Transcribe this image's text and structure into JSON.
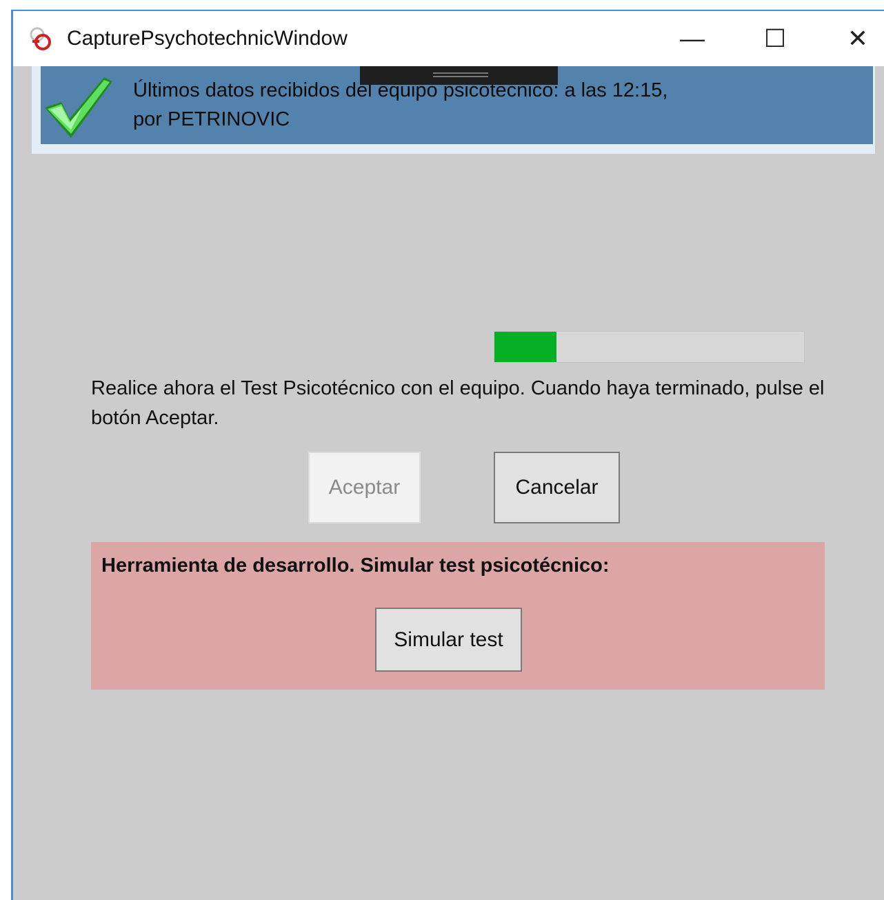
{
  "window": {
    "title": "CapturePsychotechnicWindow",
    "controls": {
      "minimize": "—",
      "maximize": "☐",
      "close": "✕"
    }
  },
  "status": {
    "icon": "check-icon",
    "line1": "Últimos datos recibidos del equipo psicotécnico: a las 12:15,",
    "line2": "por PETRINOVIC"
  },
  "progress": {
    "value_percent": 20,
    "color": "#06b025"
  },
  "instructions": "Realice ahora el Test Psicotécnico con el equipo. Cuando haya terminado, pulse el botón Aceptar.",
  "buttons": {
    "accept": "Aceptar",
    "cancel": "Cancelar"
  },
  "dev_tools": {
    "title": "Herramienta de desarrollo. Simular test psicotécnico:",
    "simulate": "Simular test",
    "background": "#dca6a6"
  },
  "colors": {
    "status_bar": "#5383ad",
    "window_border": "#4a8fd6"
  }
}
